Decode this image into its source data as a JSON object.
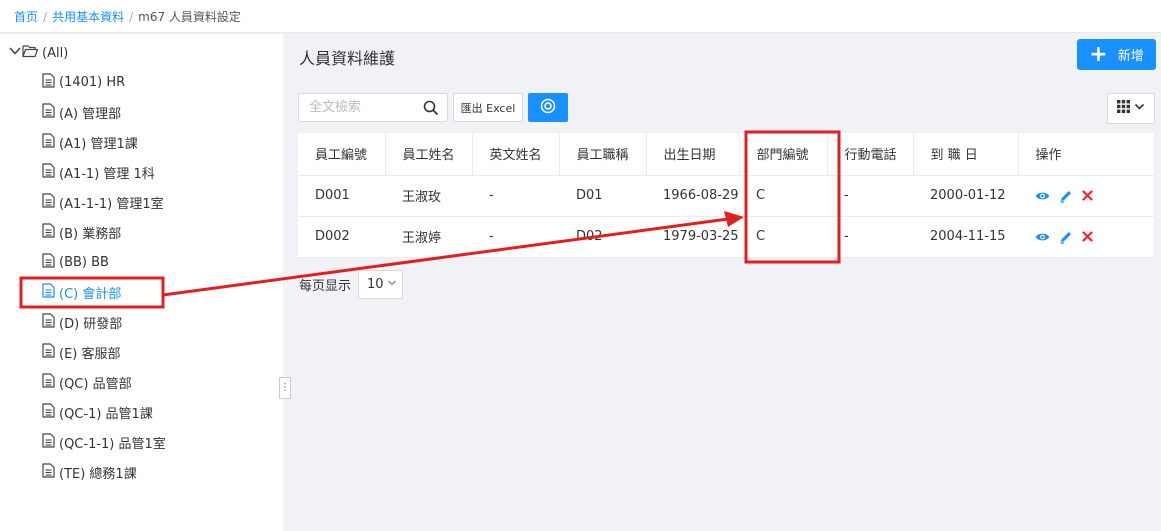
{
  "breadcrumb": {
    "items": [
      "首页",
      "共用基本資料",
      "m67 人員資料設定"
    ]
  },
  "tree": {
    "root_label": "(All)",
    "items": [
      "(1401) HR",
      "(A) 管理部",
      "(A1) 管理1課",
      "(A1-1) 管理 1科",
      "(A1-1-1) 管理1室",
      "(B) 業務部",
      "(BB) BB",
      "(C) 會計部",
      "(D) 研發部",
      "(E) 客服部",
      "(QC) 品管部",
      "(QC-1) 品管1課",
      "(QC-1-1) 品管1室",
      "(TE) 總務1課"
    ],
    "active_item": "(C) 會計部"
  },
  "main": {
    "title": "人員資料維護",
    "add_label": "新增",
    "search_placeholder": "全文檢索",
    "export_label": "匯出 Excel",
    "page_size_label": "每页显示",
    "page_size_value": "10"
  },
  "table": {
    "headers": [
      "員工編號",
      "員工姓名",
      "英文姓名",
      "員工職稱",
      "出生日期",
      "部門編號",
      "行動電話",
      "到 職 日",
      "操作"
    ],
    "rows": [
      [
        "D001",
        "王淑玫",
        "-",
        "D01",
        "1966-08-29",
        "C",
        "-",
        "2000-01-12"
      ],
      [
        "D002",
        "王淑婷",
        "-",
        "D02",
        "1979-03-25",
        "C",
        "-",
        "2004-11-15"
      ]
    ]
  },
  "colors": {
    "accent": "#1890ff",
    "annotation_red": "#e02020",
    "delete_red": "#f5222d"
  },
  "icons": [
    "folder-open-icon",
    "document-icon",
    "search-icon",
    "target-icon",
    "grid-icon",
    "eye-icon",
    "edit-icon",
    "delete-icon",
    "plus-icon"
  ]
}
